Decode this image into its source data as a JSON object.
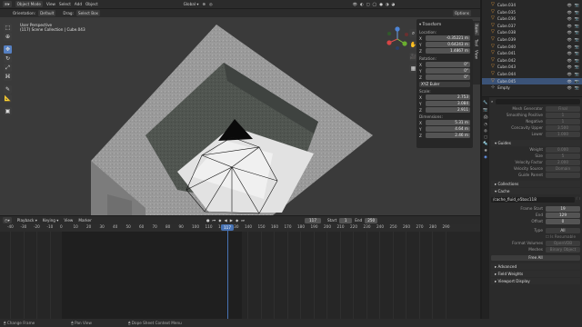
{
  "topbar": {
    "mode": "Object Mode",
    "menus": [
      "View",
      "Select",
      "Add",
      "Object"
    ],
    "orientation_label": "Orientation:",
    "orientation_value": "Default",
    "drag_label": "Drag:",
    "drag_value": "Select Box",
    "transform_space": "Global",
    "options": "Options"
  },
  "viewport": {
    "view_name": "User Perspective",
    "collection_path": "(117) Scene Collection | Cube.043"
  },
  "npanel": {
    "transform_title": "Transform",
    "tabs": [
      "Item",
      "Tool",
      "View"
    ],
    "location_label": "Location:",
    "location": [
      {
        "axis": "X",
        "value": "-0.35221 m"
      },
      {
        "axis": "Y",
        "value": "0.64243 m"
      },
      {
        "axis": "Z",
        "value": "1.4867 m"
      }
    ],
    "rotation_label": "Rotation:",
    "rotation": [
      {
        "axis": "X",
        "value": "0°"
      },
      {
        "axis": "Y",
        "value": "0°"
      },
      {
        "axis": "Z",
        "value": "0°"
      }
    ],
    "rotation_mode": "XYZ Euler",
    "scale_label": "Scale:",
    "scale": [
      {
        "axis": "X",
        "value": "2.753"
      },
      {
        "axis": "Y",
        "value": "3.084"
      },
      {
        "axis": "Z",
        "value": "2.911"
      }
    ],
    "dimensions_label": "Dimensions:",
    "dimensions": [
      {
        "axis": "X",
        "value": "5.31 m"
      },
      {
        "axis": "Y",
        "value": "4.64 m"
      },
      {
        "axis": "Z",
        "value": "2.46 m"
      }
    ]
  },
  "outliner": {
    "items": [
      "Cube.034",
      "Cube.035",
      "Cube.036",
      "Cube.037",
      "Cube.038",
      "Cube.039",
      "Cube.040",
      "Cube.041",
      "Cube.042",
      "Cube.043",
      "Cube.044",
      "Cube.045",
      "Empty"
    ],
    "selected": "Cube.045"
  },
  "properties": {
    "rows_top": [
      {
        "label": "Mesh Generator",
        "value": "Final"
      },
      {
        "label": "Smoothing Positive",
        "value": "1"
      },
      {
        "label": "Negative",
        "value": "1"
      },
      {
        "label": "Concavity Upper",
        "value": "3.500"
      },
      {
        "label": "Lower",
        "value": "1.000"
      }
    ],
    "guides_title": "Guides",
    "guides_rows": [
      {
        "label": "Weight",
        "value": "0.000"
      },
      {
        "label": "Size",
        "value": "5"
      },
      {
        "label": "Velocity Factor",
        "value": "2.000"
      },
      {
        "label": "Velocity Source",
        "value": "Domain"
      },
      {
        "label": "Guide Parent",
        "value": ""
      }
    ],
    "collections_title": "Collections",
    "cache_title": "Cache",
    "cache_path": "/cache_fluid_e5bac118",
    "cache_rows": [
      {
        "label": "Frame Start",
        "value": "19"
      },
      {
        "label": "End",
        "value": "129"
      },
      {
        "label": "Offset",
        "value": "0"
      }
    ],
    "type_label": "Type",
    "type_value": "All",
    "resumable": "Is Resumable",
    "format_volumes_label": "Format Volumes",
    "format_volumes_value": "OpenVDB",
    "meshes_label": "Meshes",
    "meshes_value": "Binary Object",
    "free_all": "Free All",
    "advanced": "Advanced",
    "field_weights": "Field Weights",
    "viewport_display": "Viewport Display"
  },
  "timeline": {
    "menus": [
      "Playback",
      "Keying",
      "View",
      "Marker"
    ],
    "current_frame": "117",
    "start_label": "Start",
    "start_value": "1",
    "end_label": "End",
    "end_value": "250",
    "ticks": [
      "-40",
      "-30",
      "-20",
      "-10",
      "0",
      "10",
      "20",
      "30",
      "40",
      "50",
      "60",
      "70",
      "80",
      "90",
      "100",
      "110",
      "117",
      "120",
      "130",
      "140",
      "150",
      "160",
      "170",
      "180",
      "190",
      "200",
      "210",
      "220",
      "230",
      "240",
      "250",
      "260",
      "270",
      "280",
      "290"
    ],
    "playhead_frame": "117"
  },
  "statusbar": {
    "items": [
      "Change Frame",
      "Pan View",
      "Dope Sheet Context Menu"
    ]
  },
  "colors": {
    "accent": "#4772b3",
    "selected_row": "#3b5378",
    "mesh_icon": "#e99e3b",
    "playhead": "#4772b3"
  }
}
